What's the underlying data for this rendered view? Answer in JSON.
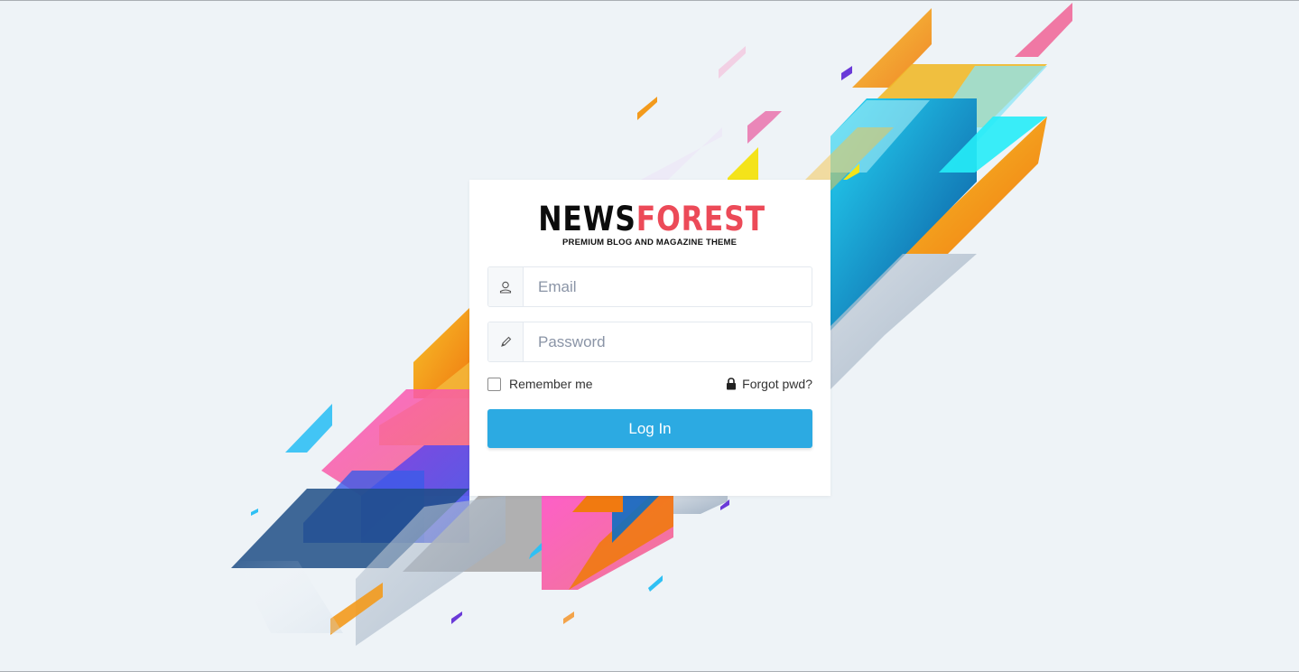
{
  "brand": {
    "title_part1": "NEWS",
    "title_part2": "FOREST",
    "tagline": "PREMIUM BLOG AND MAGAZINE THEME"
  },
  "form": {
    "email": {
      "value": "",
      "placeholder": "Email",
      "icon": "user-icon"
    },
    "password": {
      "value": "",
      "placeholder": "Password",
      "icon": "pencil-icon"
    },
    "remember_label": "Remember me",
    "remember_checked": false,
    "forgot_label": "Forgot pwd?",
    "forgot_icon": "lock-icon",
    "submit_label": "Log In"
  },
  "colors": {
    "accent": "#2caae2",
    "brand_red": "#ec4a58",
    "background": "#eef3f7"
  }
}
